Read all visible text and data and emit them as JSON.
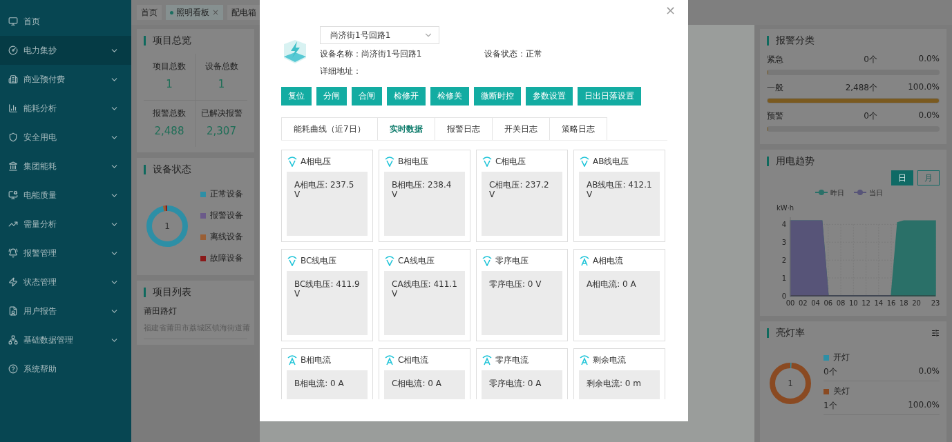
{
  "sidebar": {
    "items": [
      {
        "label": "首页",
        "kind": "link",
        "selected": false
      },
      {
        "label": "电力集抄",
        "kind": "group",
        "selected": true
      },
      {
        "label": "商业预付费",
        "kind": "group",
        "selected": false
      },
      {
        "label": "能耗分析",
        "kind": "group",
        "selected": false
      },
      {
        "label": "安全用电",
        "kind": "group",
        "selected": false
      },
      {
        "label": "集团能耗",
        "kind": "group",
        "selected": false
      },
      {
        "label": "电能质量",
        "kind": "group",
        "selected": false
      },
      {
        "label": "需量分析",
        "kind": "group",
        "selected": false
      },
      {
        "label": "报警管理",
        "kind": "group",
        "selected": false
      },
      {
        "label": "状态管理",
        "kind": "group",
        "selected": false
      },
      {
        "label": "用户报告",
        "kind": "group",
        "selected": false
      },
      {
        "label": "基础数据管理",
        "kind": "group",
        "selected": false
      },
      {
        "label": "系统帮助",
        "kind": "link",
        "selected": false
      }
    ]
  },
  "page_tabs": [
    {
      "label": "首页",
      "selected": false,
      "closable": false
    },
    {
      "label": "照明看板",
      "selected": true,
      "closable": true,
      "close": "×"
    },
    {
      "label": "配电箱",
      "selected": false,
      "closable": false
    }
  ],
  "overview": {
    "title": "项目总览",
    "stats": [
      {
        "label": "项目总数",
        "value": "1"
      },
      {
        "label": "设备总数",
        "value": "1"
      },
      {
        "label": "报警总数",
        "value": "2,488"
      },
      {
        "label": "已解决报警",
        "value": "2,307"
      }
    ]
  },
  "device_status": {
    "title": "设备状态",
    "center": "1",
    "legend": [
      {
        "label": "正常设备",
        "color": "#2d8fa6"
      },
      {
        "label": "报警设备",
        "color": "#6b5a8a"
      },
      {
        "label": "离线设备",
        "color": "#9a5f35"
      },
      {
        "label": "故障设备",
        "color": "#8a1a1a"
      }
    ]
  },
  "project_list": {
    "title": "项目列表",
    "items": [
      {
        "name": "莆田路灯",
        "address": "福建省莆田市荔城区镇海街道莆"
      }
    ]
  },
  "alarm_types": {
    "title": "报警分类",
    "rows": [
      {
        "label": "紧急",
        "count": "0个",
        "percent": "0.0%",
        "level": 0
      },
      {
        "label": "一般",
        "count": "2,488个",
        "percent": "100.0%",
        "level": 1
      },
      {
        "label": "预警",
        "count": "0个",
        "percent": "0.0%",
        "level": 0
      }
    ]
  },
  "usage_trend": {
    "title": "用电趋势",
    "toggles": [
      {
        "label": "日",
        "selected": true
      },
      {
        "label": "月",
        "selected": false
      }
    ],
    "chart_data": {
      "type": "area",
      "ylabel": "kW·h",
      "x": [
        0,
        1,
        2,
        3,
        4,
        5,
        6,
        7,
        8,
        9,
        10,
        11,
        12,
        13,
        14,
        15,
        16,
        17,
        18,
        19,
        20,
        21,
        22,
        23
      ],
      "grid": true,
      "legend": "top",
      "series": [
        {
          "name": "昨日",
          "color": "#2a7068",
          "values": [
            4.2,
            4.2,
            4.2,
            4.2,
            4.2,
            4.2,
            0,
            0,
            0,
            0,
            0,
            0,
            0,
            0,
            0,
            0,
            0,
            4.1,
            4.2,
            4.2,
            4.2,
            4.2,
            4.2,
            4.2
          ]
        },
        {
          "name": "当日",
          "color": "#575478",
          "values": [
            4.2,
            4.2,
            4.2,
            4.2,
            4.2,
            4.2,
            0,
            0,
            0,
            0,
            0,
            0,
            0,
            0,
            0,
            0,
            0,
            null,
            null,
            null,
            null,
            null,
            null,
            null
          ]
        }
      ],
      "xlim": [
        0,
        23
      ],
      "ylim": [
        0,
        4.4
      ],
      "yticks": [
        0,
        1,
        2,
        3,
        4
      ],
      "xticks": [
        {
          "value": 0,
          "label": "00"
        },
        {
          "value": 2,
          "label": "02"
        },
        {
          "value": 4,
          "label": "04"
        },
        {
          "value": 6,
          "label": "06"
        },
        {
          "value": 8,
          "label": "08"
        },
        {
          "value": 10,
          "label": "10"
        },
        {
          "value": 12,
          "label": "12"
        },
        {
          "value": 14,
          "label": "14"
        },
        {
          "value": 16,
          "label": "16"
        },
        {
          "value": 18,
          "label": "18"
        },
        {
          "value": 20,
          "label": "20"
        },
        {
          "value": 23,
          "label": "23"
        }
      ]
    }
  },
  "light_rate": {
    "title": "亮灯率",
    "center": "1",
    "legend": [
      {
        "label": "开灯",
        "count": "0个",
        "percent": "0.0%",
        "color": "#2d8fa6"
      },
      {
        "label": "关灯",
        "count": "1个",
        "percent": "100.0%",
        "color": "#8a4a22"
      }
    ]
  },
  "modal": {
    "close": "×",
    "select": {
      "value": "尚济街1号回路1"
    },
    "info": [
      {
        "label": "设备名称：",
        "value": "尚济街1号回路1"
      },
      {
        "label": "设备状态：",
        "value": "正常"
      },
      {
        "label": "详细地址："
      }
    ],
    "buttons": [
      "复位",
      "分闸",
      "合闸",
      "检修开",
      "检修关",
      "微断时控",
      "参数设置",
      "日出日落设置"
    ],
    "tabs": [
      {
        "label": "能耗曲线（近7日）",
        "selected": false
      },
      {
        "label": "实时数据",
        "selected": true
      },
      {
        "label": "报警日志",
        "selected": false
      },
      {
        "label": "开关日志",
        "selected": false
      },
      {
        "label": "策略日志",
        "selected": false
      }
    ],
    "cards": [
      {
        "title": "A相电压",
        "kind": "voltage",
        "value": "A相电压: 237.5 V"
      },
      {
        "title": "B相电压",
        "kind": "voltage",
        "value": "B相电压: 238.4 V"
      },
      {
        "title": "C相电压",
        "kind": "voltage",
        "value": "C相电压: 237.2 V"
      },
      {
        "title": "AB线电压",
        "kind": "voltage",
        "value": "AB线电压: 412.1 V"
      },
      {
        "title": "BC线电压",
        "kind": "voltage",
        "value": "BC线电压: 411.9 V"
      },
      {
        "title": "CA线电压",
        "kind": "voltage",
        "value": "CA线电压: 411.1 V"
      },
      {
        "title": "零序电压",
        "kind": "voltage",
        "value": "零序电压: 0 V"
      },
      {
        "title": "A相电流",
        "kind": "current",
        "value": "A相电流: 0 A"
      },
      {
        "title": "B相电流",
        "kind": "current",
        "value": "B相电流: 0 A"
      },
      {
        "title": "C相电流",
        "kind": "current",
        "value": "C相电流: 0 A"
      },
      {
        "title": "零序电流",
        "kind": "current",
        "value": "零序电流: 0 A"
      },
      {
        "title": "剩余电流",
        "kind": "current",
        "value": "剩余电流: 0 m"
      }
    ]
  }
}
